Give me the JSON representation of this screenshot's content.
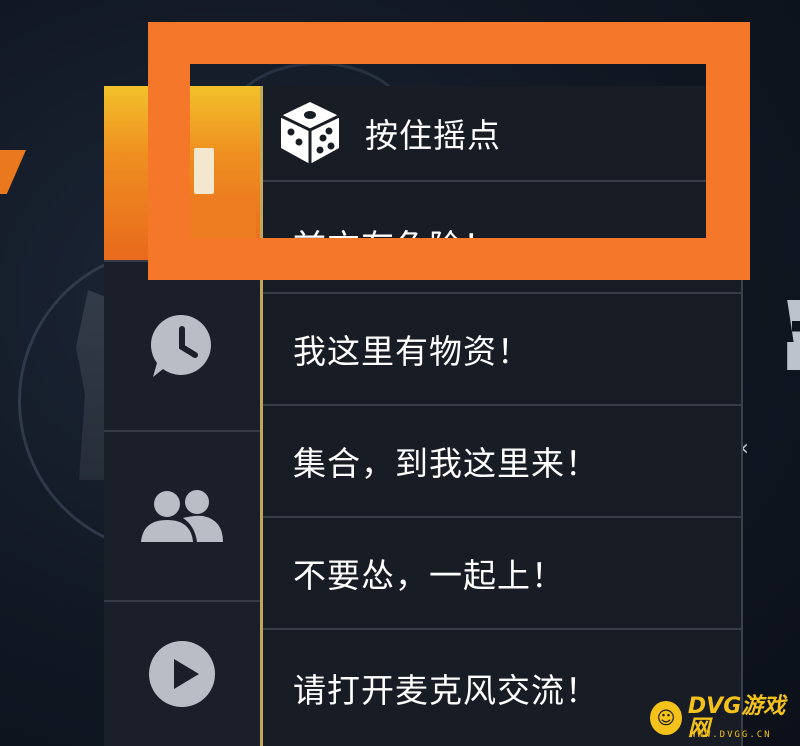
{
  "menu": {
    "messages": [
      {
        "id": "hold-roll",
        "label": "按住摇点",
        "icon": "dice-icon"
      },
      {
        "id": "partial",
        "label": "前方有危险！"
      },
      {
        "id": "supplies",
        "label": "我这里有物资！"
      },
      {
        "id": "gather",
        "label": "集合，到我这里来！"
      },
      {
        "id": "charge",
        "label": "不要怂，一起上！"
      },
      {
        "id": "mic",
        "label": "请打开麦克风交流！"
      }
    ],
    "tabs": [
      {
        "id": "quick-chat",
        "icon": "chat-bubble-icon",
        "active": true
      },
      {
        "id": "history",
        "icon": "clock-bubble-icon",
        "active": false
      },
      {
        "id": "team",
        "icon": "people-icon",
        "active": false
      },
      {
        "id": "play",
        "icon": "play-circle-icon",
        "active": false
      }
    ]
  },
  "highlight_color": "#f5782a",
  "watermark": {
    "logo_glyph": "☺",
    "text": "DVG游戏网",
    "sub": "WWW.DVGG.CN"
  }
}
